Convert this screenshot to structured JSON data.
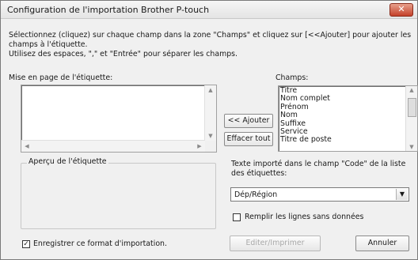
{
  "window": {
    "title": "Configuration de l'importation Brother P-touch",
    "close_glyph": "✕"
  },
  "instructions": {
    "line1": "Sélectionnez (cliquez) sur chaque champ dans la zone \"Champs\" et cliquez sur [<<Ajouter] pour ajouter les champs à l'étiquette.",
    "line2": "Utilisez des espaces, \",\" et \"Entrée\" pour séparer les champs."
  },
  "layout_box": {
    "label": "Mise en page de l'étiquette:",
    "content": ""
  },
  "fields": {
    "label": "Champs:",
    "items": [
      "Titre",
      "Nom complet",
      "Prénom",
      "Nom",
      "Suffixe",
      "Service",
      "Titre de poste"
    ]
  },
  "buttons": {
    "add": "<< Ajouter",
    "clear_all": "Effacer tout",
    "edit_print": "Editer/Imprimer",
    "cancel": "Annuler"
  },
  "preview": {
    "label": "Aperçu de l'étiquette"
  },
  "code_field": {
    "label": "Texte importé dans le champ \"Code\" de la liste des étiquettes:",
    "selected": "Dép/Région",
    "fill_empty_label": "Remplir les lignes sans données",
    "fill_empty_checked": false
  },
  "save_format": {
    "label": "Enregistrer ce format d'importation.",
    "checked": true
  },
  "icons": {
    "check": "✓",
    "arrow_up": "▲",
    "arrow_down": "▼",
    "arrow_left": "◀",
    "arrow_right": "▶",
    "combo_down": "▼"
  }
}
